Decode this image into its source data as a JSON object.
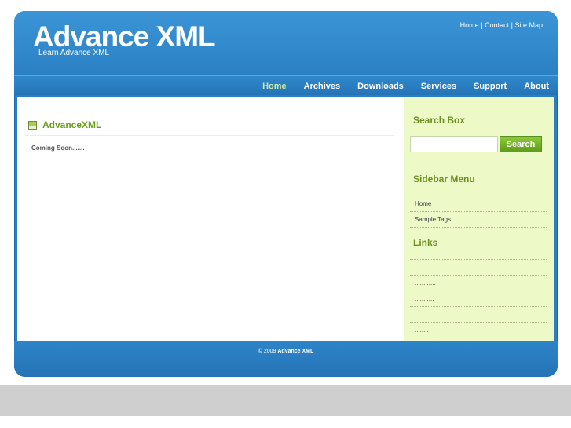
{
  "header": {
    "title": "Advance XML",
    "tagline": "Learn Advance XML",
    "toplinks": [
      "Home",
      "Contact",
      "Site Map"
    ],
    "separator": "|"
  },
  "nav": {
    "items": [
      "Home",
      "Archives",
      "Downloads",
      "Services",
      "Support",
      "About"
    ],
    "active_index": 0
  },
  "content": {
    "post_title": "AdvanceXML",
    "post_body": "Coming Soon......."
  },
  "sidebar": {
    "search_heading": "Search Box",
    "search_value": "",
    "search_button": "Search",
    "menu_heading": "Sidebar Menu",
    "menu_items": [
      "Home",
      "Sample Tags"
    ],
    "links_heading": "Links",
    "links": [
      "..........",
      "............",
      "...........",
      ".......",
      "........"
    ]
  },
  "footer": {
    "copyright": "© 2009",
    "site": "Advance XML"
  },
  "colors": {
    "frame_blue": "#2a7fc2",
    "active_nav": "#cde9a0",
    "sidebar_bg": "#edf9c7",
    "heading_green": "#6d8f1e",
    "button_green": "#6fae23"
  }
}
